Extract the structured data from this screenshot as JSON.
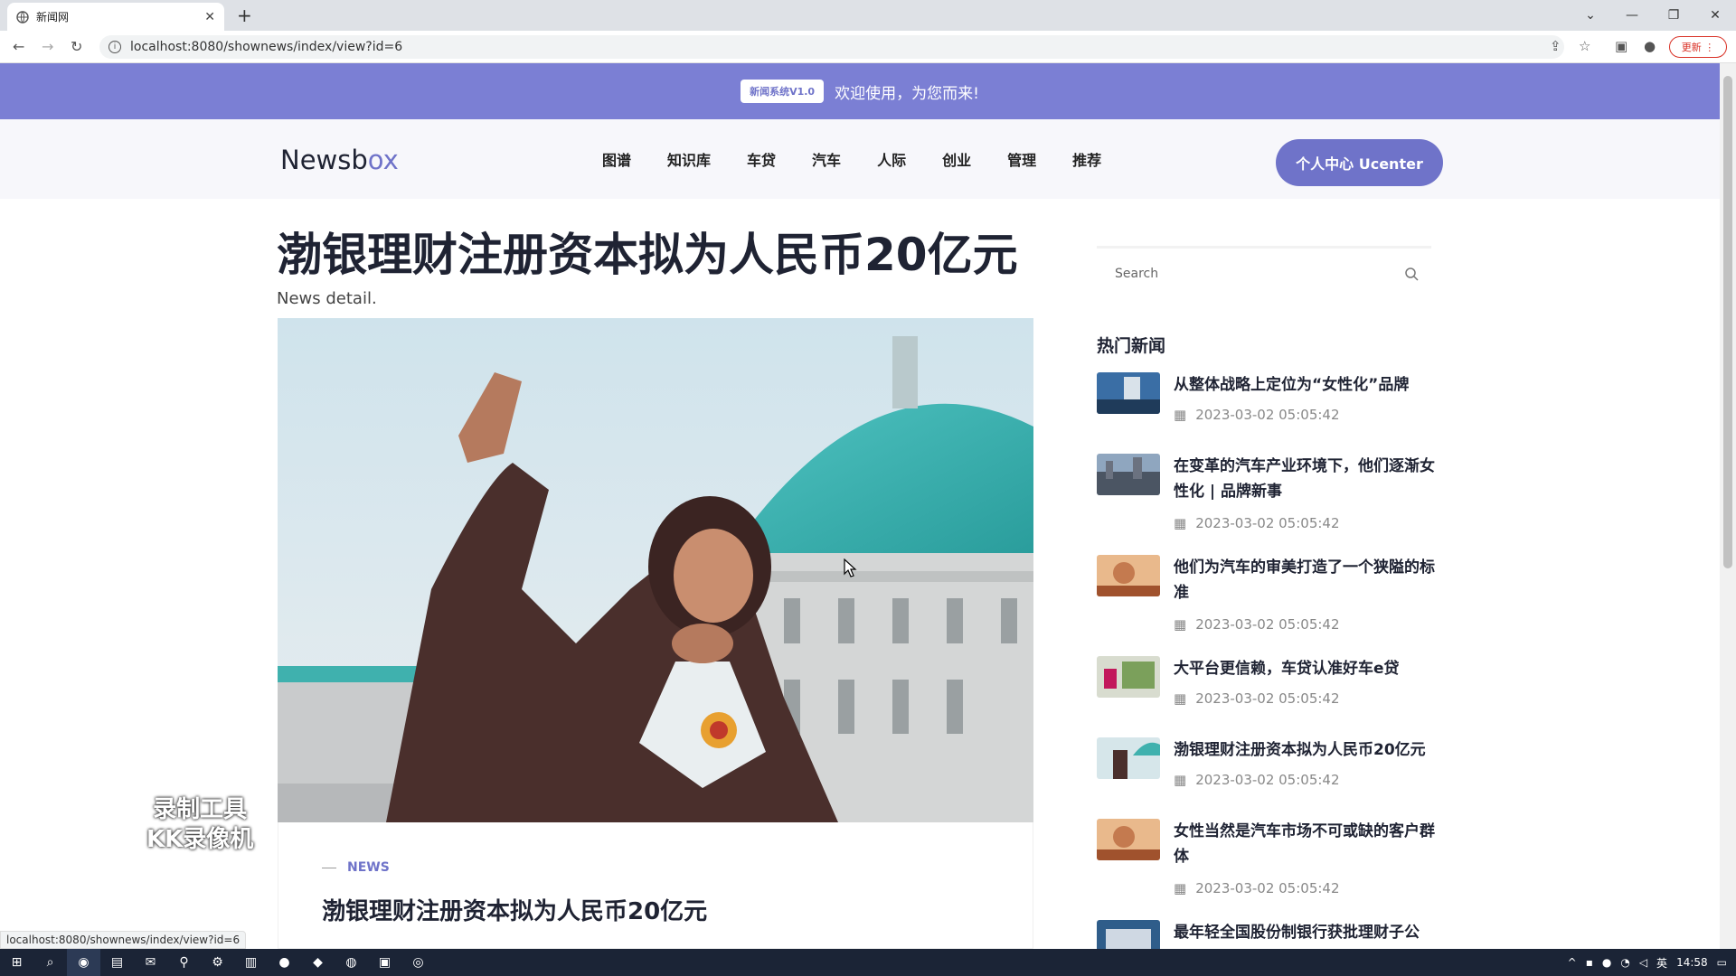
{
  "browser": {
    "tab_title": "新闻网",
    "url": "localhost:8080/shownews/index/view?id=6",
    "update_label": "更新",
    "status_url": "localhost:8080/shownews/index/view?id=6"
  },
  "banner": {
    "badge": "新闻系统V1.0",
    "message": "欢迎使用，为您而来!"
  },
  "header": {
    "logo_prefix": "News",
    "logo_b": "b",
    "logo_ox": "ox",
    "menu": [
      "图谱",
      "知识库",
      "车贷",
      "汽车",
      "人际",
      "创业",
      "管理",
      "推荐"
    ],
    "ucenter_label": "个人中心 Ucenter"
  },
  "article": {
    "title": "渤银理财注册资本拟为人民币20亿元",
    "subtitle": "News detail.",
    "tag": "NEWS",
    "card_title": "渤银理财注册资本拟为人民币20亿元"
  },
  "sidebar": {
    "search_placeholder": "Search",
    "hot_title": "热门新闻",
    "items": [
      {
        "title": "从整体战略上定位为“女性化”品牌",
        "date": "2023-03-02 05:05:42"
      },
      {
        "title": "在变革的汽车产业环境下，他们逐渐女性化 | 品牌新事",
        "date": "2023-03-02 05:05:42"
      },
      {
        "title": "他们为汽车的审美打造了一个狭隘的标准",
        "date": "2023-03-02 05:05:42"
      },
      {
        "title": "大平台更信赖，车贷认准好车e贷",
        "date": "2023-03-02 05:05:42"
      },
      {
        "title": "渤银理财注册资本拟为人民币20亿元",
        "date": "2023-03-02 05:05:42"
      },
      {
        "title": "女性当然是汽车市场不可或缺的客户群体",
        "date": "2023-03-02 05:05:42"
      },
      {
        "title": "最年轻全国股份制银行获批理财子公",
        "date": ""
      }
    ]
  },
  "watermark": {
    "line1": "录制工具",
    "line2": "KK录像机"
  },
  "taskbar": {
    "ime": "英",
    "time": "14:58"
  }
}
